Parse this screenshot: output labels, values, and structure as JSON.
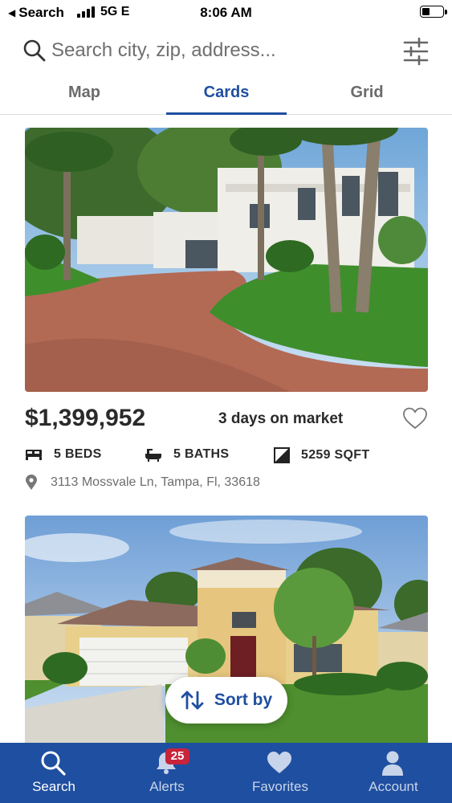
{
  "status_bar": {
    "back_label": "Search",
    "network": "5G E",
    "time": "8:06 AM"
  },
  "search": {
    "placeholder": "Search city, zip, address..."
  },
  "tabs": [
    {
      "label": "Map",
      "active": false
    },
    {
      "label": "Cards",
      "active": true
    },
    {
      "label": "Grid",
      "active": false
    }
  ],
  "listings": [
    {
      "price": "$1,399,952",
      "days_on_market": "3 days on market",
      "beds": "5 BEDS",
      "baths": "5 BATHS",
      "sqft": "5259 SQFT",
      "address": "3113 Mossvale Ln, Tampa, Fl, 33618",
      "favorited": false
    },
    {
      "price": "",
      "days_on_market": "",
      "beds": "",
      "baths": "",
      "sqft": "",
      "address": ""
    }
  ],
  "sort_button": {
    "label": "Sort by"
  },
  "bottom_nav": [
    {
      "label": "Search",
      "icon": "search-icon",
      "active": true
    },
    {
      "label": "Alerts",
      "icon": "bell-icon",
      "badge": "25",
      "active": false
    },
    {
      "label": "Favorites",
      "icon": "heart-icon",
      "active": false
    },
    {
      "label": "Account",
      "icon": "person-icon",
      "active": false
    }
  ],
  "colors": {
    "brand_blue": "#1f4fa0",
    "badge_red": "#c8243b",
    "text_dark": "#2a2a2a",
    "text_muted": "#6d6d6d"
  }
}
